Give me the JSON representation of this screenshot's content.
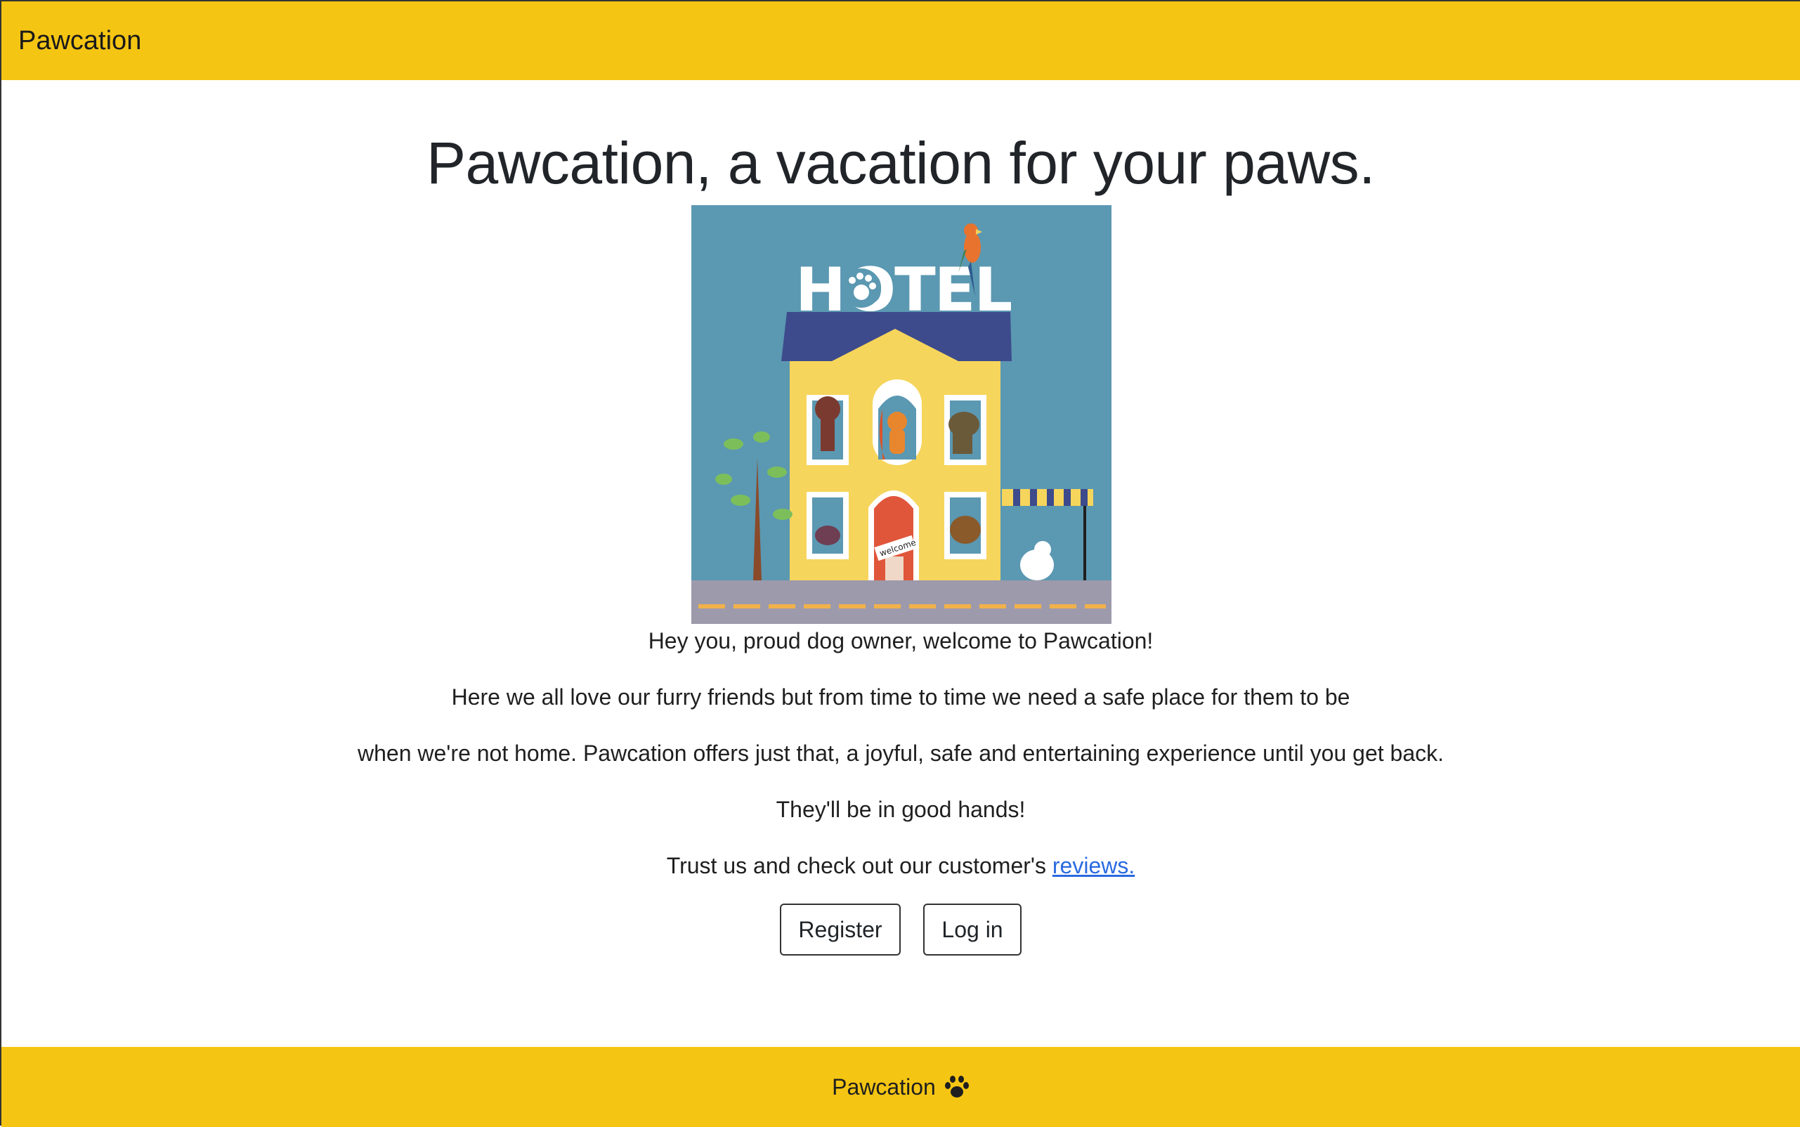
{
  "navbar": {
    "brand": "Pawcation"
  },
  "hero": {
    "headline": "Pawcation, a vacation for your paws.",
    "image_sign": "HOTEL",
    "image_door_sign": "welcome"
  },
  "intro": {
    "line1": "Hey you, proud dog owner, welcome to Pawcation!",
    "line2": "Here we all love our furry friends but from time to time we need a safe place for them to be",
    "line3": "when we're not home. Pawcation offers just that, a joyful, safe and entertaining experience until you get back.",
    "line4": "They'll be in good hands!",
    "trust_prefix": "Trust us and check out our customer's ",
    "reviews_link": "reviews."
  },
  "actions": {
    "register": "Register",
    "login": "Log in"
  },
  "footer": {
    "text": "Pawcation",
    "icon": "paw-icon"
  },
  "colors": {
    "accent": "#f5c513",
    "link": "#2a6ae0",
    "text": "#212529"
  }
}
